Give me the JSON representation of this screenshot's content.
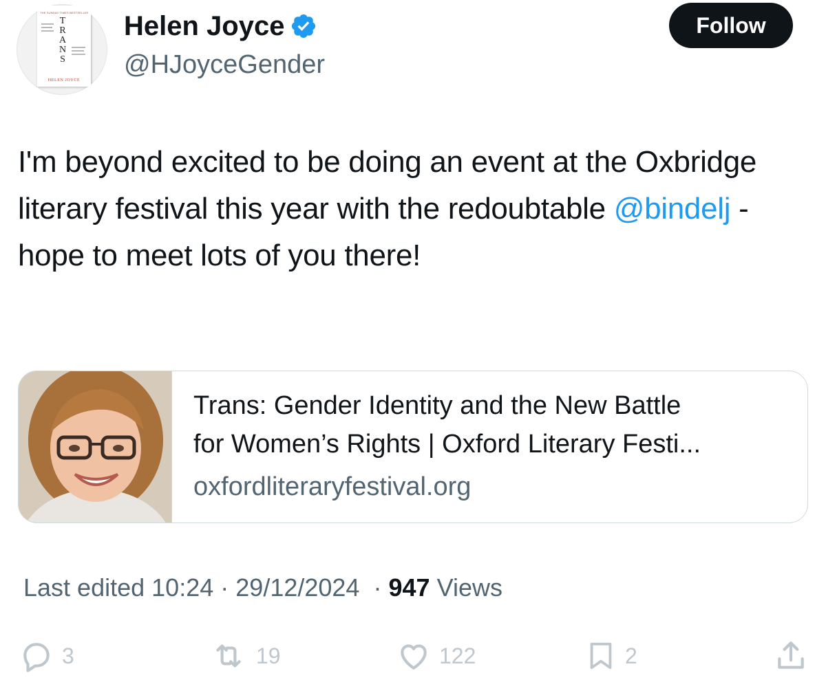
{
  "author": {
    "display_name": "Helen Joyce",
    "handle": "@HJoyceGender",
    "verified_icon": "verified-badge-icon",
    "avatar": {
      "book_tagline": "THE SUNDAY TIMES BESTSELLER",
      "book_title": "TRANS",
      "book_author": "HELEN JOYCE"
    }
  },
  "follow_button": {
    "label": "Follow"
  },
  "tweet": {
    "text_part1": "I'm beyond excited to be doing an event at the Oxbridge literary festival this year with the redoubtable ",
    "mention": "@bindelj",
    "text_part2": " - hope to meet lots of you there!"
  },
  "link_card": {
    "title_line1": "Trans: Gender Identity and the New Battle",
    "title_line2": "for Women’s Rights | Oxford Literary Festi...",
    "domain": "oxfordliteraryfestival.org"
  },
  "meta": {
    "edited_prefix": "Last edited",
    "time": "10:24",
    "date": "29/12/2024",
    "separator": "·",
    "views_count": "947",
    "views_label": "Views"
  },
  "actions": {
    "replies": "3",
    "reposts": "19",
    "likes": "122",
    "bookmarks": "2"
  },
  "colors": {
    "accent": "#1d9bf0",
    "text_primary": "#0f1419",
    "text_secondary": "#536471",
    "action_icon": "#bfc7ce",
    "follow_bg": "#0f1419"
  }
}
